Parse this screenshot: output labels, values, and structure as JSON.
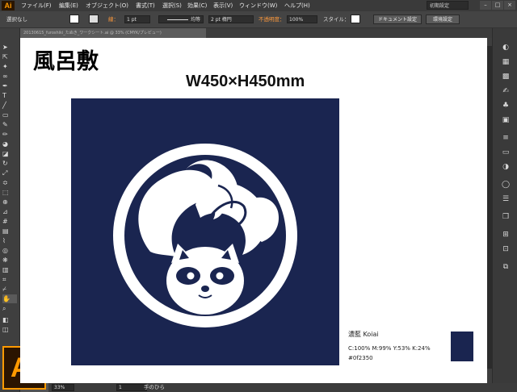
{
  "app": {
    "logo": "Ai",
    "workspace": "初期設定"
  },
  "menu": [
    "ファイル(F)",
    "編集(E)",
    "オブジェクト(O)",
    "書式(T)",
    "選択(S)",
    "効果(C)",
    "表示(V)",
    "ウィンドウ(W)",
    "ヘルプ(H)"
  ],
  "window_controls": [
    "–",
    "□",
    "×"
  ],
  "control_bar": {
    "selection_label": "選択なし",
    "stroke_label": "線：",
    "stroke_value": "1 pt",
    "profile_label": "均等",
    "brush_value": "2 pt 楕円",
    "opacity_label": "不透明度：",
    "opacity_value": "100%",
    "style_label": "スタイル：",
    "doc_settings_button": "ドキュメント設定",
    "preferences_button": "環境設定"
  },
  "document_tab": "20130615_furoshiki_たぬき_ワークシート.ai @ 33% (CMYK/プレビュー)",
  "artwork": {
    "title": "風呂敷",
    "size_label": "W450×H450mm",
    "color_name": "濃藍 Koiai",
    "color_cmyk": "C:100% M:99% Y:53% K:24%",
    "color_hex": "#0f2350",
    "navy": "#1a2550"
  },
  "status": {
    "zoom": "33%",
    "page": "1",
    "tool_name": "手のひら"
  },
  "tools": [
    "selection-tool-icon",
    "direct-selection-tool-icon",
    "magic-wand-icon",
    "lasso-icon",
    "pen-tool-icon",
    "type-tool-icon",
    "line-tool-icon",
    "rectangle-tool-icon",
    "paintbrush-icon",
    "pencil-icon",
    "blob-brush-icon",
    "eraser-icon",
    "rotate-icon",
    "scale-icon",
    "width-tool-icon",
    "free-transform-icon",
    "shape-builder-icon",
    "perspective-icon",
    "mesh-icon",
    "gradient-icon",
    "eyedropper-icon",
    "blend-icon",
    "symbol-sprayer-icon",
    "graph-icon",
    "artboard-icon",
    "slice-icon",
    "hand-tool-icon",
    "zoom-tool-icon"
  ],
  "panel_icons": [
    "color-panel-icon",
    "color-guide-icon",
    "swatches-icon",
    "brushes-icon",
    "symbols-icon",
    "graphic-styles-icon",
    "stroke-panel-icon",
    "gradient-panel-icon",
    "transparency-panel-icon",
    "appearance-panel-icon",
    "layers-panel-icon",
    "artboards-panel-icon",
    "align-panel-icon",
    "transform-panel-icon",
    "pathfinder-panel-icon"
  ]
}
